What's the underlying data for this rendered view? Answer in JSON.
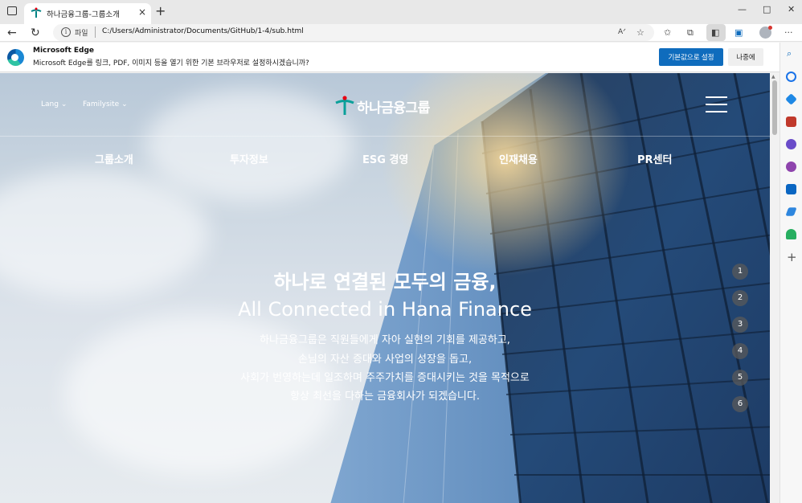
{
  "browser": {
    "tab_title": "하나금융그룹-그룹소개",
    "new_tab": "+",
    "close_tab": "×",
    "file_label": "파일",
    "url": "C:/Users/Administrator/Documents/GitHub/1-4/sub.html",
    "window_controls": [
      "—",
      "□",
      "✕"
    ],
    "toolbar_more": "···"
  },
  "notification": {
    "title": "Microsoft Edge",
    "message": "Microsoft Edge를 링크, PDF, 이미지 등을 열기 위한 기본 브라우저로 설정하시겠습니까?",
    "primary_button": "기본값으로 설정",
    "secondary_button": "나중에"
  },
  "page": {
    "util_lang": "Lang",
    "util_family": "Familysite",
    "logo_text": "하나금융그룹",
    "gnb": [
      "그룹소개",
      "투자정보",
      "ESG 경영",
      "인재채용",
      "PR센터"
    ],
    "hero_title": "하나로 연결된 모두의 금융,",
    "hero_sub": "All Connected in Hana Finance",
    "hero_lines": [
      "하나금융그룹은 직원들에게 자아 실현의 기회를 제공하고,",
      "손님의 자산 증대와 사업의 성장을 돕고,",
      "사회가 번영하는데 일조하며 주주가치를 증대시키는 것을 목적으로",
      "항상 최선을 다하는 금융회사가 되겠습니다."
    ],
    "pager": [
      "1",
      "2",
      "3",
      "4",
      "5",
      "6"
    ]
  },
  "colors": {
    "brand": "#008485",
    "edge_blue": "#0f6cbd"
  }
}
